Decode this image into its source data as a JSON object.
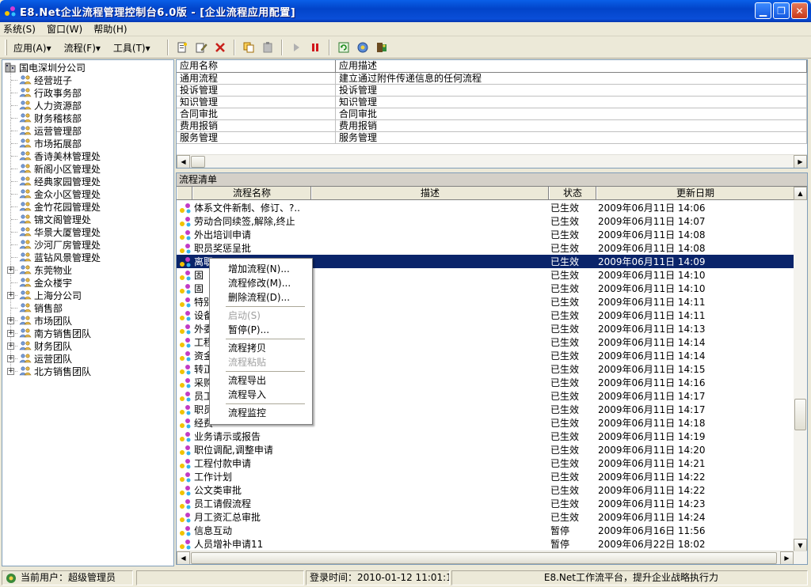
{
  "window": {
    "title": "E8.Net企业流程管理控制台6.0版 - [企业流程应用配置]"
  },
  "menubar": [
    "系统(S)",
    "窗口(W)",
    "帮助(H)"
  ],
  "toolbar": {
    "menus": [
      "应用(A)▾",
      "流程(F)▾",
      "工具(T)▾"
    ]
  },
  "tree": {
    "root": "国电深圳分公司",
    "items": [
      {
        "label": "经营班子",
        "expandable": false
      },
      {
        "label": "行政事务部",
        "expandable": false
      },
      {
        "label": "人力资源部",
        "expandable": false
      },
      {
        "label": "财务稽核部",
        "expandable": false
      },
      {
        "label": "运营管理部",
        "expandable": false
      },
      {
        "label": "市场拓展部",
        "expandable": false
      },
      {
        "label": "香诗美林管理处",
        "expandable": false
      },
      {
        "label": "新阁小区管理处",
        "expandable": false
      },
      {
        "label": "经典家园管理处",
        "expandable": false
      },
      {
        "label": "金众小区管理处",
        "expandable": false
      },
      {
        "label": "金竹花园管理处",
        "expandable": false
      },
      {
        "label": "锦文阁管理处",
        "expandable": false
      },
      {
        "label": "华景大厦管理处",
        "expandable": false
      },
      {
        "label": "沙河厂房管理处",
        "expandable": false
      },
      {
        "label": "蓝钻风景管理处",
        "expandable": false
      },
      {
        "label": "东莞物业",
        "expandable": true
      },
      {
        "label": "金众楼宇",
        "expandable": false
      },
      {
        "label": "上海分公司",
        "expandable": true
      },
      {
        "label": "销售部",
        "expandable": false
      },
      {
        "label": "市场团队",
        "expandable": true
      },
      {
        "label": "南方销售团队",
        "expandable": true
      },
      {
        "label": "财务团队",
        "expandable": true
      },
      {
        "label": "运营团队",
        "expandable": true
      },
      {
        "label": "北方销售团队",
        "expandable": true
      }
    ]
  },
  "apps": {
    "columns": [
      "应用名称",
      "应用描述"
    ],
    "rows": [
      [
        "通用流程",
        "建立通过附件传递信息的任何流程"
      ],
      [
        "投诉管理",
        "投诉管理"
      ],
      [
        "知识管理",
        "知识管理"
      ],
      [
        "合同审批",
        "合同审批"
      ],
      [
        "费用报销",
        "费用报销"
      ],
      [
        "服务管理",
        "服务管理"
      ]
    ]
  },
  "flows": {
    "caption": "流程清单",
    "columns": [
      "流程名称",
      "描述",
      "状态",
      "更新日期"
    ],
    "rows": [
      {
        "name": "体系文件新制、修订、?..",
        "status": "已生效",
        "date": "2009年06月11日  14:06"
      },
      {
        "name": "劳动合同续签,解除,终止",
        "status": "已生效",
        "date": "2009年06月11日  14:07"
      },
      {
        "name": "外出培训申请",
        "status": "已生效",
        "date": "2009年06月11日  14:08"
      },
      {
        "name": "职员奖惩呈批",
        "status": "已生效",
        "date": "2009年06月11日  14:08"
      },
      {
        "name": "离职",
        "status": "已生效",
        "date": "2009年06月11日  14:09"
      },
      {
        "name": "固",
        "status": "已生效",
        "date": "2009年06月11日  14:10"
      },
      {
        "name": "固",
        "status": "已生效",
        "date": "2009年06月11日  14:10"
      },
      {
        "name": "特别",
        "status": "已生效",
        "date": "2009年06月11日  14:11"
      },
      {
        "name": "设备",
        "status": "已生效",
        "date": "2009年06月11日  14:11"
      },
      {
        "name": "外委",
        "status": "已生效",
        "date": "2009年06月11日  14:13"
      },
      {
        "name": "工程",
        "status": "已生效",
        "date": "2009年06月11日  14:14"
      },
      {
        "name": "资金",
        "status": "已生效",
        "date": "2009年06月11日  14:14"
      },
      {
        "name": "转正",
        "status": "已生效",
        "date": "2009年06月11日  14:15"
      },
      {
        "name": "采购",
        "status": "已生效",
        "date": "2009年06月11日  14:16"
      },
      {
        "name": "员工",
        "status": "已生效",
        "date": "2009年06月11日  14:17"
      },
      {
        "name": "职员",
        "status": "已生效",
        "date": "2009年06月11日  14:17"
      },
      {
        "name": "经费",
        "status": "已生效",
        "date": "2009年06月11日  14:18"
      },
      {
        "name": "业务请示或报告",
        "status": "已生效",
        "date": "2009年06月11日  14:19"
      },
      {
        "name": "职位调配,调整申请",
        "status": "已生效",
        "date": "2009年06月11日  14:20"
      },
      {
        "name": "工程付款申请",
        "status": "已生效",
        "date": "2009年06月11日  14:21"
      },
      {
        "name": "工作计划",
        "status": "已生效",
        "date": "2009年06月11日  14:22"
      },
      {
        "name": "公文类审批",
        "status": "已生效",
        "date": "2009年06月11日  14:22"
      },
      {
        "name": "员工请假流程",
        "status": "已生效",
        "date": "2009年06月11日  14:23"
      },
      {
        "name": "月工资汇总审批",
        "status": "已生效",
        "date": "2009年06月11日  14:24"
      },
      {
        "name": "信息互动",
        "status": "暂停",
        "date": "2009年06月16日  11:56"
      },
      {
        "name": "人员增补申请11",
        "status": "暂停",
        "date": "2009年06月22日  18:02"
      }
    ]
  },
  "context_menu": {
    "items": [
      {
        "label": "增加流程(N)...",
        "enabled": true
      },
      {
        "label": "流程修改(M)...",
        "enabled": true
      },
      {
        "label": "删除流程(D)...",
        "enabled": true
      },
      {
        "sep": true
      },
      {
        "label": "启动(S)",
        "enabled": false
      },
      {
        "label": "暂停(P)...",
        "enabled": true
      },
      {
        "sep": true
      },
      {
        "label": "流程拷贝",
        "enabled": true
      },
      {
        "label": "流程粘贴",
        "enabled": false
      },
      {
        "sep": true
      },
      {
        "label": "流程导出",
        "enabled": true
      },
      {
        "label": "流程导入",
        "enabled": true
      },
      {
        "sep": true
      },
      {
        "label": "流程监控",
        "enabled": true
      }
    ]
  },
  "status": {
    "user": "当前用户：超级管理员",
    "login": "登录时间：2010-01-12 11:01:15",
    "slogan": "E8.Net工作流平台，提升企业战略执行力"
  }
}
